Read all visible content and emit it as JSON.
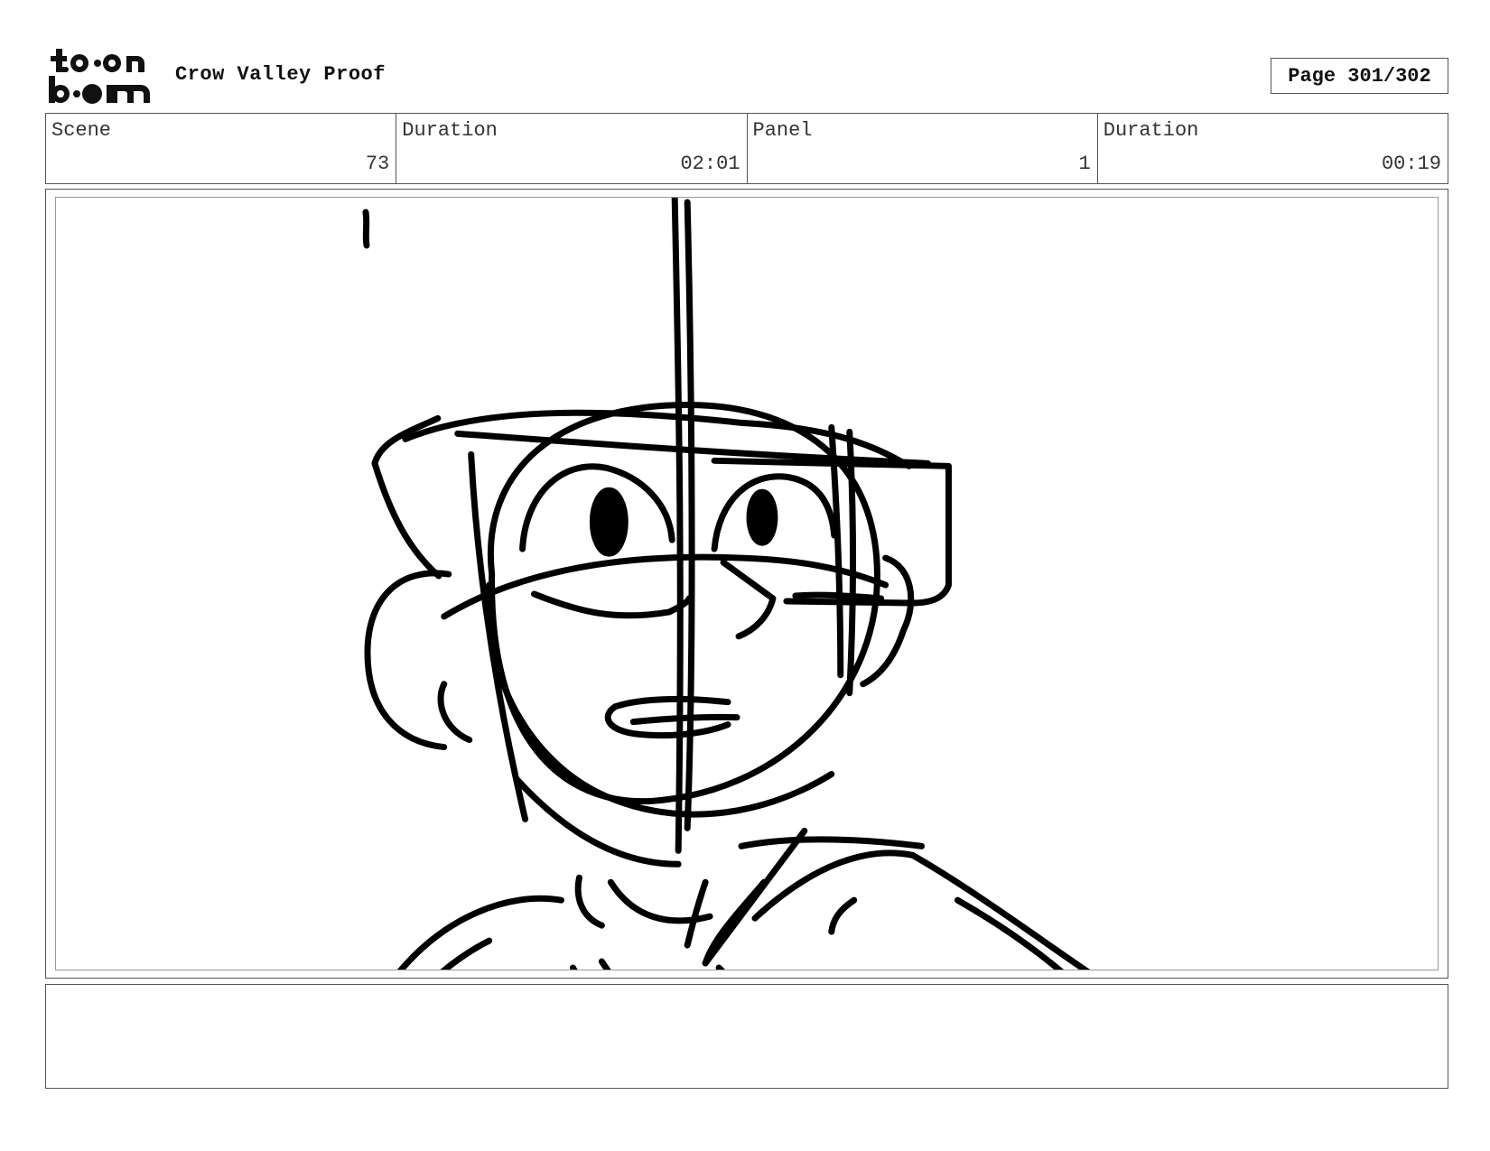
{
  "header": {
    "logo_text": "toon boom",
    "project_title": "Crow Valley Proof",
    "page_label": "Page 301/302"
  },
  "info": {
    "scene_label": "Scene",
    "scene_value": "73",
    "duration_label": "Duration",
    "duration_value": "02:01",
    "panel_label": "Panel",
    "panel_value": "1",
    "panel_duration_label": "Duration",
    "panel_duration_value": "00:19"
  },
  "panel": {
    "image": "rough sketch drawing"
  },
  "caption": {
    "text": ""
  }
}
